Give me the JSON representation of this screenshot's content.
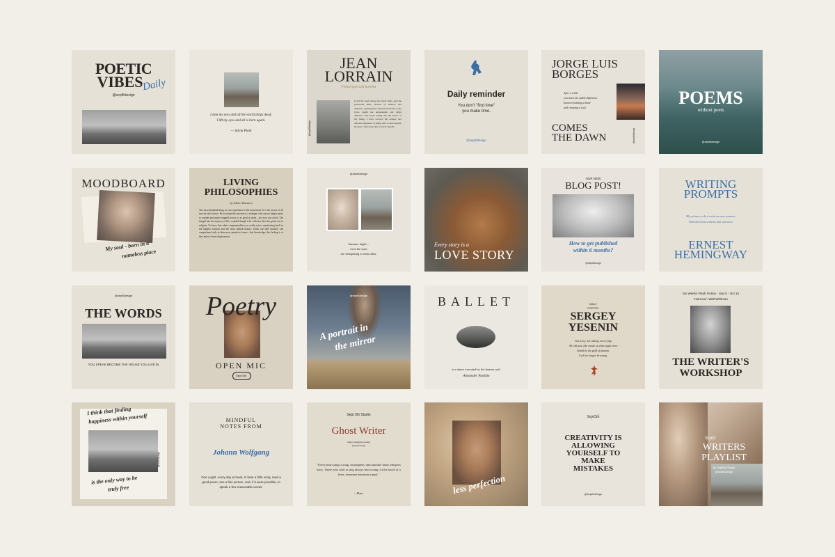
{
  "tiles": {
    "t1": {
      "title1": "POETIC",
      "title2": "VIBES",
      "script": "Daily",
      "handle": "@sept5design"
    },
    "t2": {
      "quote1": "I shut my eyes and all the world drops dead;",
      "quote2": "I lift my eyes and all is born again.",
      "author": "— Sylvia Plath"
    },
    "t3": {
      "title1": "JEAN",
      "title2": "LORRAIN",
      "subtitle": "French poet and novelist",
      "body": "I laid my head among the black lilies. And the poisonous lilies, flowers of shadow and darkness, opening their funereal blossoms at my brow, taught me unspeakable and virgin dishonor. And weak, living into the horror of my being, I have savored the strange and delicate happiness of being able to hate myself, because I have been able to know myself.",
      "handle": "@sept5design"
    },
    "t4": {
      "title": "Daily reminder",
      "line1": "You don't \"find time\"",
      "line2": "you make time.",
      "handle": "@sept5design"
    },
    "t5": {
      "title1": "JORGE LUIS",
      "title2": "BORGES",
      "poem": "After a while\nyou learn the subtle difference\nbetween holding a hand\nand chaining a soul.",
      "bottom1": "COMES",
      "bottom2": "THE DAWN",
      "handle": "@sept5design"
    },
    "t6": {
      "title": "POEMS",
      "subtitle": "without poets",
      "handle": "@sept5design"
    },
    "t7": {
      "title": "MOODBOARD",
      "script1": "My soul - born in a",
      "script2": "nameless place"
    },
    "t8": {
      "title1": "LIVING",
      "title2": "PHILOSOPHIES",
      "byline": "by Albert Einstein",
      "body": "The most beautiful thing we can experience is the mysterious. It is the source of all true art and science. He to whom the emotion is a stranger, who can no longer pause to wonder and stand wrapped in awe, is as good as dead —his eyes are closed. The insight into the mystery of life, coupled though it be with fear, has also given rise to religion. To know that what is impenetrable to us really exists, manifesting itself as the highest wisdom and the most radiant beauty, which our dull faculties can comprehend only in their most primitive forms—this knowledge, this feeling is at the center of true religiousness."
    },
    "t9": {
      "handle": "@sept5design",
      "line1": "Summer night—",
      "line2": "even the stars",
      "line3": "are whispering to each other."
    },
    "t10": {
      "script": "Every story is a",
      "title": "LOVE STORY"
    },
    "t11": {
      "pre": "OUR NEW",
      "title": "BLOG POST!",
      "script1": "How to get published",
      "script2": "within 6 months?",
      "handle": "@sept5design"
    },
    "t12": {
      "title1": "WRITING",
      "title2": "PROMPTS",
      "line1": "All you have to do is write one true sentence.",
      "line2": "Write the truest sentence that you know.",
      "author1": "ERNEST",
      "author2": "HEMINGWAY"
    },
    "t13": {
      "handle": "@sept5design",
      "title": "THE WORDS",
      "caption": "YOU SPEAK BECOME THE HOUSE YOU LIVE IN"
    },
    "t14": {
      "script": "Poetry",
      "title": "OPEN MIC",
      "date": "Sept 5th"
    },
    "t15": {
      "handle": "@sept5design",
      "script1": "A portrait in",
      "script2": "the mirror"
    },
    "t16": {
      "title": "BALLET",
      "line": "is a dance executed by the human soul.",
      "author": "Alexander Pushkin"
    },
    "t17": {
      "pre1": "DAILY",
      "pre2": "POETRY",
      "title1": "SERGEY",
      "title2": "YESENIN",
      "poem": "Not sorry, not calling, not crying\nAll will pass like smoke of white apple trees\nSeized by the gold of autumn,\nI will no longer be young."
    },
    "t18": {
      "header1": "Six Weeks Flash Fiction · Sep 5 - Oct 10",
      "header2": "Instructor: Walt Whitman",
      "title1": "THE WRITER'S",
      "title2": "WORKSHOP"
    },
    "t19": {
      "script1": "I think that finding",
      "script2": "happiness within yourself",
      "script3": "is the only way to be",
      "script4": "truly free",
      "handle": "@sept5design"
    },
    "t20": {
      "title1": "MINDFUL",
      "title2": "NOTES FROM",
      "script": "Johann Wolfgang",
      "body": "One ought, every day at least, to hear a little song, read a good poem, see a fine picture, and, if it were possible, to speak a few reasonable words."
    },
    "t21": {
      "studio": "Sept 5th Studio",
      "title": "Ghost Writer",
      "sub1": "Daily instagram poems",
      "sub2": "@sept5design",
      "quote": "\"Every heart sings a song, incomplete, until another heart whispers back. Those who wish to sing always find a song. At the touch of a lover, everyone becomes a poet.\"",
      "author": "~ Plato"
    },
    "t22": {
      "script": "less perfection"
    },
    "t23": {
      "logo": "Sept5th",
      "title": "CREATIVITY IS ALLOWING YOURSELF TO MAKE MISTAKES",
      "handle": "@sept5design"
    },
    "t24": {
      "script": "Sept5",
      "title1": "WRITERS",
      "title2": "PLAYLIST",
      "sub1": "by Sept5th Studio",
      "sub2": "@sept5design"
    }
  },
  "colors": {
    "background": "#f2efe9",
    "accent_blue": "#3a6ea5",
    "accent_red": "#8a3a2a",
    "ink": "#2a2622"
  }
}
